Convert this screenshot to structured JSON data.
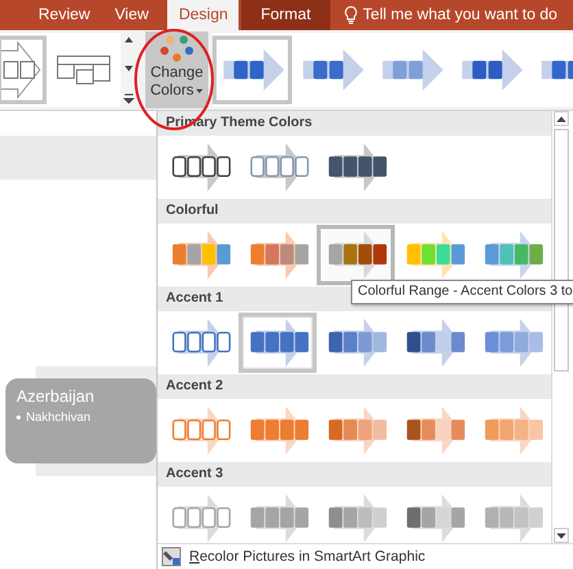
{
  "tabs": [
    {
      "label": "Review",
      "selected": false
    },
    {
      "label": "View",
      "selected": false
    },
    {
      "label": "Design",
      "selected": true
    },
    {
      "label": "Format",
      "selected": false,
      "kind": "contextual"
    }
  ],
  "tell_me": {
    "placeholder": "Tell me what you want to do"
  },
  "layout_gallery": [
    {
      "selected": true
    },
    {
      "selected": false
    }
  ],
  "change_colors": {
    "label": "Change Colors",
    "pressed": true
  },
  "style_gallery": [
    {
      "selected": true
    },
    {
      "selected": false
    },
    {
      "selected": false
    },
    {
      "selected": false
    },
    {
      "selected": false
    }
  ],
  "color_menu": {
    "sections": [
      {
        "title": "Primary Theme Colors",
        "options": [
          {
            "kind": "outline",
            "selected": false,
            "hovered": false
          },
          {
            "kind": "outline",
            "selected": false,
            "hovered": false
          },
          {
            "kind": "fill",
            "selected": false,
            "hovered": false
          }
        ]
      },
      {
        "title": "Colorful",
        "options": [
          {
            "kind": "fill",
            "selected": false,
            "hovered": false
          },
          {
            "kind": "fill",
            "selected": false,
            "hovered": false
          },
          {
            "kind": "fill",
            "selected": false,
            "hovered": true
          },
          {
            "kind": "fill",
            "selected": false,
            "hovered": false
          },
          {
            "kind": "fill",
            "selected": false,
            "hovered": false
          }
        ]
      },
      {
        "title": "Accent 1",
        "options": [
          {
            "kind": "outline",
            "selected": false,
            "hovered": false
          },
          {
            "kind": "fill",
            "selected": true,
            "hovered": false
          },
          {
            "kind": "fill",
            "selected": false,
            "hovered": false
          },
          {
            "kind": "fill",
            "selected": false,
            "hovered": false
          },
          {
            "kind": "fill",
            "selected": false,
            "hovered": false
          }
        ]
      },
      {
        "title": "Accent 2",
        "options": [
          {
            "kind": "outline",
            "selected": false,
            "hovered": false
          },
          {
            "kind": "fill",
            "selected": false,
            "hovered": false
          },
          {
            "kind": "fill",
            "selected": false,
            "hovered": false
          },
          {
            "kind": "fill",
            "selected": false,
            "hovered": false
          },
          {
            "kind": "fill",
            "selected": false,
            "hovered": false
          }
        ]
      },
      {
        "title": "Accent 3",
        "options": [
          {
            "kind": "outline",
            "selected": false,
            "hovered": false
          },
          {
            "kind": "fill",
            "selected": false,
            "hovered": false
          },
          {
            "kind": "fill",
            "selected": false,
            "hovered": false
          },
          {
            "kind": "fill",
            "selected": false,
            "hovered": false
          },
          {
            "kind": "fill",
            "selected": false,
            "hovered": false
          }
        ]
      }
    ],
    "footer": "Recolor Pictures in SmartArt Graphic"
  },
  "tooltip": "Colorful Range - Accent Colors 3 to",
  "canvas": {
    "shape": {
      "title": "Azerbaijan",
      "bullets": [
        "Nakhchivan"
      ]
    }
  }
}
